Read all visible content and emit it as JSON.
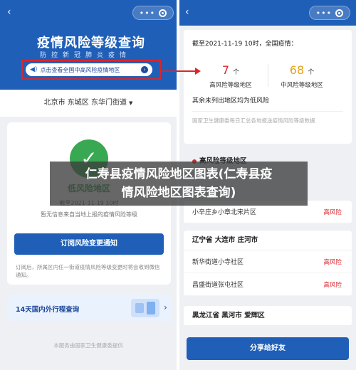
{
  "left": {
    "back": "‹",
    "title": "疫情风险等级查询",
    "subtitle": "防控新冠肺炎疫情",
    "notice": "点击查看全国中高风险疫情地区",
    "location": "北京市 东城区 东华门街道",
    "status_label": "低风险地区",
    "as_of": "截至2021-11-19 10时",
    "no_info": "暂无信息来自当地上报的疫情风险等级",
    "subscribe_button": "订阅风险变更通知",
    "subscribe_note": "订阅后，所属区内任一街道疫情风险等级变更时将会收到微信通知。",
    "trip_title": "14天国内外行程查询",
    "footer": "本服务由国家卫生健康委提供"
  },
  "right": {
    "back": "‹",
    "as_of": "截至2021-11-19 10时，全国疫情：",
    "high_count": "7",
    "mid_count": "68",
    "count_unit": "个",
    "high_label": "高风险等级地区",
    "mid_label": "中风险等级地区",
    "others_low": "其余未列出地区均为低风险",
    "source": "国家卫生健康委每日汇总各地报送疫情风险等级数据",
    "section_header": "高风险等级地区",
    "block1": {
      "rows": [
        {
          "name": "小辛庄乡小章北宋片区",
          "level": "高风险"
        }
      ]
    },
    "block2": {
      "header": "辽宁省 大连市 庄河市",
      "rows": [
        {
          "name": "新华街道小寺社区",
          "level": "高风险"
        },
        {
          "name": "昌盛街道张屯社区",
          "level": "高风险"
        }
      ]
    },
    "block3": {
      "header": "黑龙江省 黑河市 爱辉区"
    },
    "share_button": "分享给好友"
  },
  "overlay": {
    "line1": "仁寿县疫情风险地区图表(仁寿县疫",
    "line2": "情风险地区图表查询)"
  },
  "colors": {
    "brand_blue": "#1f5fb8",
    "high_risk": "#d8262c",
    "mid_risk": "#e6a21b",
    "low_risk": "#2f9a49"
  }
}
